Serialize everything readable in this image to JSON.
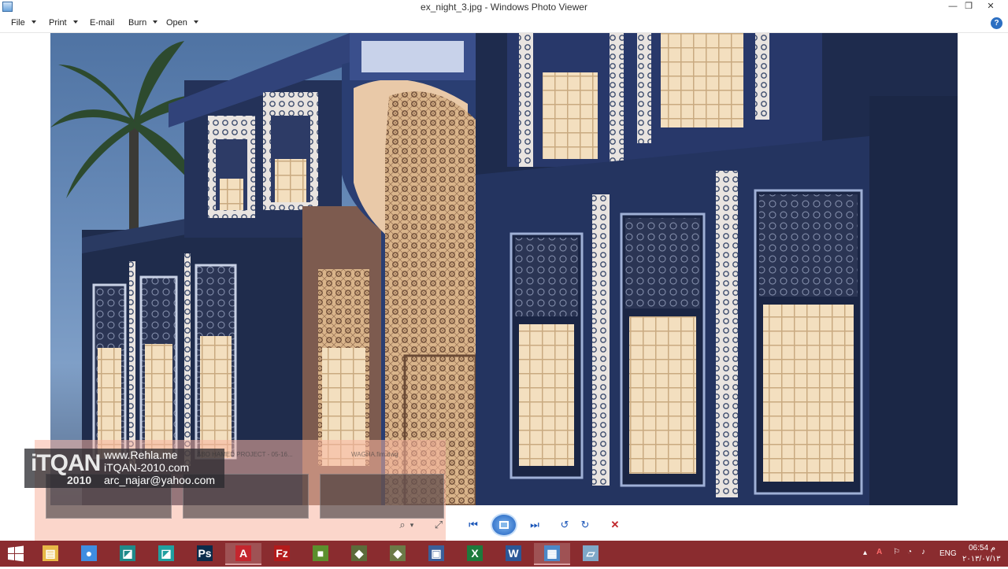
{
  "window": {
    "title": "ex_night_3.jpg - Windows Photo Viewer",
    "minimize": "—",
    "restore": "❒",
    "close": "✕"
  },
  "menu": {
    "file": "File",
    "print": "Print",
    "email": "E-mail",
    "burn": "Burn",
    "open": "Open",
    "help": "?"
  },
  "watermark": {
    "logo": "iTQAN",
    "year": "2010",
    "lines": [
      "www.Rehla.me",
      "iTQAN-2010.com",
      "arc_najar@yahoo.com"
    ],
    "thumbnail_labels": [
      "ABO HAMED PROJECT - 05-16...",
      "WAGHA.fim.dwg"
    ]
  },
  "navbar": {
    "zoom": "⌕",
    "zoom_caret": "▾",
    "fit": "⤢",
    "previous": "⏮",
    "next": "⏭",
    "rotate_left": "↺",
    "rotate_right": "↻",
    "delete": "✕"
  },
  "taskbar": {
    "apps": [
      {
        "name": "file-explorer",
        "glyph": "▤",
        "color": "#e7b847"
      },
      {
        "name": "chrome",
        "glyph": "●",
        "color": "#3f8de0"
      },
      {
        "name": "3ds-max-1",
        "glyph": "◪",
        "color": "#1f8a8a"
      },
      {
        "name": "3ds-max-2",
        "glyph": "◪",
        "color": "#20a0a0"
      },
      {
        "name": "photoshop",
        "glyph": "Ps",
        "color": "#0b2b4a"
      },
      {
        "name": "autocad",
        "glyph": "A",
        "color": "#c4262e"
      },
      {
        "name": "filezilla",
        "glyph": "Fz",
        "color": "#b31b1b"
      },
      {
        "name": "app-green",
        "glyph": "■",
        "color": "#5b8f2d"
      },
      {
        "name": "app-olive-1",
        "glyph": "◆",
        "color": "#5c6b3a"
      },
      {
        "name": "app-olive-2",
        "glyph": "◆",
        "color": "#6b7a47"
      },
      {
        "name": "network-app",
        "glyph": "▣",
        "color": "#3a5f9a"
      },
      {
        "name": "excel",
        "glyph": "X",
        "color": "#1d7a3c"
      },
      {
        "name": "word",
        "glyph": "W",
        "color": "#2b5797"
      },
      {
        "name": "photo-viewer",
        "glyph": "▦",
        "color": "#4b88c8"
      },
      {
        "name": "notepad",
        "glyph": "▱",
        "color": "#7fa8c8"
      }
    ],
    "tray": {
      "chevron": "▴",
      "language": "ENG",
      "time": "06:54 م",
      "date": "٢٠١٣/٠٧/١٣"
    }
  }
}
